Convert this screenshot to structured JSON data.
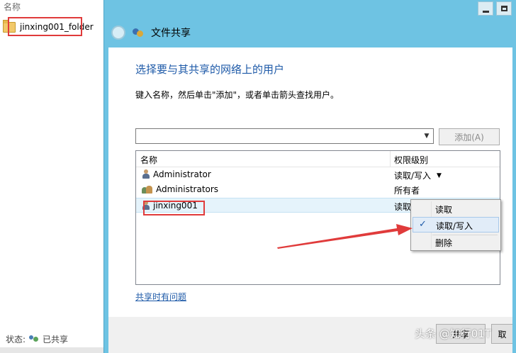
{
  "explorer": {
    "column_header": "名称",
    "folder_name": "jinxing001_folder",
    "status_label": "状态:",
    "status_value": "已共享"
  },
  "dialog": {
    "title": "文件共享",
    "heading": "选择要与其共享的网络上的用户",
    "instruction": "键入名称，然后单击\"添加\"，或者单击箭头查找用户。",
    "name_input_value": "",
    "add_button": "添加(A)",
    "columns": {
      "name": "名称",
      "permission": "权限级别"
    },
    "rows": [
      {
        "name": "Administrator",
        "permission": "读取/写入",
        "icon": "user-icon"
      },
      {
        "name": "Administrators",
        "permission": "所有者",
        "icon": "group-icon"
      },
      {
        "name": "jinxing001",
        "permission": "读取",
        "icon": "user-icon"
      }
    ],
    "context_menu": {
      "items": [
        {
          "label": "读取",
          "checked": false
        },
        {
          "label": "读取/写入",
          "checked": true
        },
        {
          "label": "删除",
          "checked": false
        }
      ],
      "check_mark": "✓"
    },
    "problem_link": "共享时有问题",
    "share_button": "共享",
    "cancel_button": "取"
  },
  "watermark": "头条 @知行01T",
  "colors": {
    "title_bar": "#6ec3e3",
    "heading": "#1e5aa8",
    "annotation": "#e03b3b"
  }
}
